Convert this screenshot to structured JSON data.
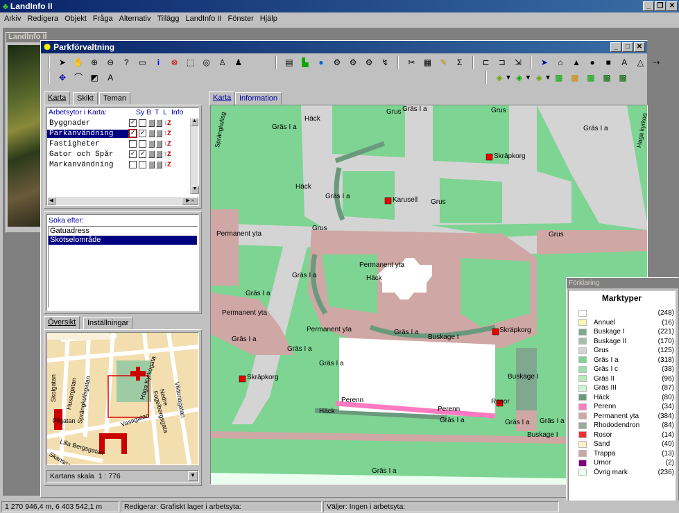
{
  "app": {
    "title": "LandInfo II",
    "icon": "landinfo-tree-icon"
  },
  "menu": [
    "Arkiv",
    "Redigera",
    "Objekt",
    "Fråga",
    "Alternativ",
    "Tillägg",
    "LandInfo II",
    "Fönster",
    "Hjälp"
  ],
  "bg_window": {
    "title": "LandInfo II Start"
  },
  "window": {
    "title": "Parkförvaltning"
  },
  "left_tabs": [
    "Karta",
    "Skikt",
    "Teman"
  ],
  "layers": {
    "header": "Arbetsytor i Karta:",
    "cols": [
      "Sy",
      "B",
      "T",
      "L",
      "Info"
    ],
    "rows": [
      {
        "name": "Byggnader",
        "sy": true,
        "b": false,
        "selected": false
      },
      {
        "name": "Parkanvändning",
        "sy": true,
        "b": true,
        "selected": true
      },
      {
        "name": "Fastigheter",
        "sy": false,
        "b": false,
        "selected": false
      },
      {
        "name": "Gator och Spår",
        "sy": true,
        "b": true,
        "selected": false
      },
      {
        "name": "Markanvändning",
        "sy": false,
        "b": false,
        "selected": false
      }
    ]
  },
  "search": {
    "label": "Söka efter:",
    "items": [
      "Gatuadress",
      "Skötselområde"
    ],
    "selected": 1
  },
  "overview_tabs": [
    "Översikt",
    "Inställningar"
  ],
  "overview_streets": [
    "Skolgatan",
    "Husargatan",
    "Sprängkullsgatan",
    "Haga Kyrkogata",
    "Viktoriagatan",
    "Nedre Fogelbergsgata",
    "Vasagatan",
    "Pilgatan",
    "Lilla Bergsgatan",
    "Skansgatan"
  ],
  "scale": {
    "label": "Kartans skala",
    "value": "1 : 776"
  },
  "map_tabs": [
    "Karta",
    "Information"
  ],
  "map_labels": {
    "l1": "Häck",
    "l2": "Gräs I a",
    "l3": "Grus",
    "l4": "Gräs I a",
    "l5": "Grus",
    "l6": "Gräs I a",
    "l7": "Skräpkorg",
    "l8": "Häck",
    "l9": "Gräs I a",
    "l10": "Karusell",
    "l11": "Grus",
    "l12": "Grus",
    "l13": "Permanent yta",
    "l14": "Grus",
    "l15": "Permanent yta",
    "l16": "Häck",
    "l17": "Gräs I a",
    "l18": "Gräs I a",
    "l19": "Permanent yta",
    "l20": "Permanent yta",
    "l21": "Gräs I a",
    "l22": "Skräpkorg",
    "l23": "Gräs I a",
    "l24": "Buskage I",
    "l25": "Gräs I a",
    "l26": "Gräs I a",
    "l27": "Skräpkorg",
    "l28": "Buskage I",
    "l29": "Perenn",
    "l30": "Rosor",
    "l31": "Häck",
    "l32": "Perenn",
    "l33": "Gräs I a",
    "l34": "Gräs I a",
    "l35": "Gräs I a",
    "l36": "Buskage I",
    "l37": "Gräs I a",
    "l38": "Sprängkullsg",
    "l39": "Haga kyrkog"
  },
  "legend": {
    "window_title": "Förklaring",
    "title": "Marktyper",
    "items": [
      {
        "name": "",
        "count": "(248)",
        "color": "#ffffff"
      },
      {
        "name": "Annuel",
        "count": "(16)",
        "color": "#fff8b0"
      },
      {
        "name": "Buskage I",
        "count": "(221)",
        "color": "#7fa88f"
      },
      {
        "name": "Buskage II",
        "count": "(170)",
        "color": "#a4bfae"
      },
      {
        "name": "Grus",
        "count": "(125)",
        "color": "#d4d4d4"
      },
      {
        "name": "Gräs I a",
        "count": "(318)",
        "color": "#7ed492"
      },
      {
        "name": "Gräs I c",
        "count": "(38)",
        "color": "#9be0a8"
      },
      {
        "name": "Gräs II",
        "count": "(96)",
        "color": "#b3ecbd"
      },
      {
        "name": "Gräs III",
        "count": "(87)",
        "color": "#cdf3d3"
      },
      {
        "name": "Häck",
        "count": "(80)",
        "color": "#6a9a7c"
      },
      {
        "name": "Perenn",
        "count": "(34)",
        "color": "#ff7ac0"
      },
      {
        "name": "Permanent yta",
        "count": "(384)",
        "color": "#cfa7a4"
      },
      {
        "name": "Rhododendron",
        "count": "(84)",
        "color": "#9aa99c"
      },
      {
        "name": "Rosor",
        "count": "(14)",
        "color": "#ee3333"
      },
      {
        "name": "Sand",
        "count": "(40)",
        "color": "#fff1c8"
      },
      {
        "name": "Trappa",
        "count": "(13)",
        "color": "#c8a8a8"
      },
      {
        "name": "Urnor",
        "count": "(2)",
        "color": "#800080"
      },
      {
        "name": "Övrig mark",
        "count": "(236)",
        "color": "#eafff0"
      }
    ]
  },
  "status": {
    "coords": "1 270 946,4 m, 6 403 542,1 m",
    "edit": "Redigerar: Grafiskt lager i arbetsyta:",
    "select": "Väljer: Ingen i arbetsyta:"
  },
  "colors": {
    "titlebar": "#0a246a",
    "grass": "#7ed492",
    "gravel": "#d4d4d4",
    "permanent": "#cfa7a4",
    "hedge": "#6a9a7c",
    "selected": "#000080"
  }
}
